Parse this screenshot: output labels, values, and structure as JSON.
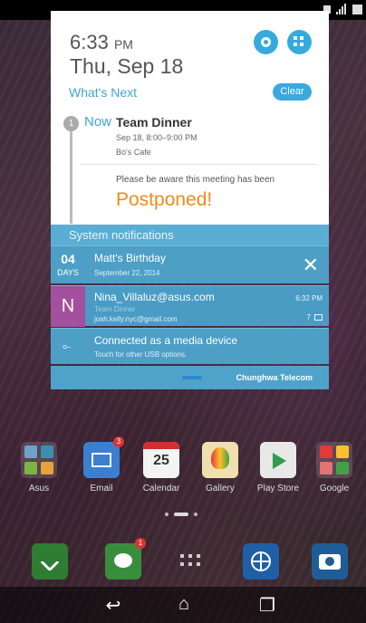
{
  "notification_panel": {
    "time": "6:33",
    "ampm": "PM",
    "date": "Thu, Sep 18",
    "whats_next_label": "What's Next",
    "clear_label": "Clear",
    "event": {
      "index": "1",
      "now_label": "Now",
      "title": "Team Dinner",
      "time": "Sep 18, 8:00–9:00 PM",
      "location": "Bo's Cafe",
      "note": "Please be aware this meeting has been",
      "status": "Postponed!"
    },
    "system_header": "System notifications",
    "notifications": [
      {
        "days_count": "04",
        "days_label": "DAYS",
        "title": "Matt's Birthday",
        "subtitle": "September 22, 2014",
        "dismiss_icon": "close-icon"
      },
      {
        "avatar_letter": "N",
        "title": "Nina_Villaluz@asus.com",
        "subtitle1": "Team Dinner",
        "subtitle2": "josh.kelly.nyc@gmail.com",
        "time": "6:32 PM",
        "count": "7",
        "icon": "mail-icon"
      },
      {
        "icon": "usb-icon",
        "title": "Connected as a media device",
        "subtitle": "Touch for other USB options."
      }
    ],
    "carrier": "Chunghwa Telecom"
  },
  "home_apps": [
    {
      "label": "Asus",
      "badge": ""
    },
    {
      "label": "Email",
      "badge": "3"
    },
    {
      "label": "Calendar",
      "badge": "",
      "icon_text": "25"
    },
    {
      "label": "Gallery",
      "badge": ""
    },
    {
      "label": "Play Store",
      "badge": ""
    },
    {
      "label": "Google",
      "badge": ""
    }
  ],
  "dock": [
    {
      "name": "phone-icon"
    },
    {
      "name": "messages-icon",
      "badge": "1"
    },
    {
      "name": "all-apps-icon"
    },
    {
      "name": "browser-icon"
    },
    {
      "name": "camera-icon"
    }
  ],
  "colors": {
    "accent": "#3ba8de",
    "notification_bg": "#4d9fc6",
    "postponed": "#f08a1c",
    "avatar": "#a3509f"
  }
}
